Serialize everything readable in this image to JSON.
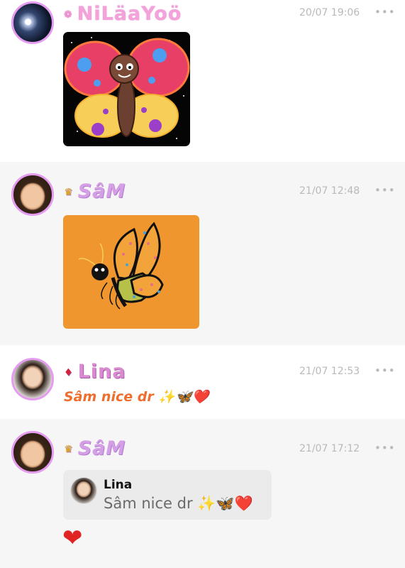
{
  "messages": [
    {
      "name": "NiLäaYoö",
      "badge": "❁",
      "time": "20/07 19:06",
      "more": "•••"
    },
    {
      "name": "SâM",
      "badge": "♛",
      "time": "21/07 12:48",
      "more": "•••"
    },
    {
      "name": "Lina",
      "badge": "♦",
      "time": "21/07 12:53",
      "more": "•••",
      "text": "Sâm nice dr ✨🦋❤️"
    },
    {
      "name": "SâM",
      "badge": "♛",
      "time": "21/07 17:12",
      "more": "•••",
      "reply": {
        "name": "Lina",
        "text": "Sâm nice dr ✨🦋❤️"
      },
      "text": "❤"
    }
  ],
  "colors": {
    "accent": "#e59cf0",
    "lina_text": "#ee6e2e",
    "time": "#b9b9b9"
  }
}
